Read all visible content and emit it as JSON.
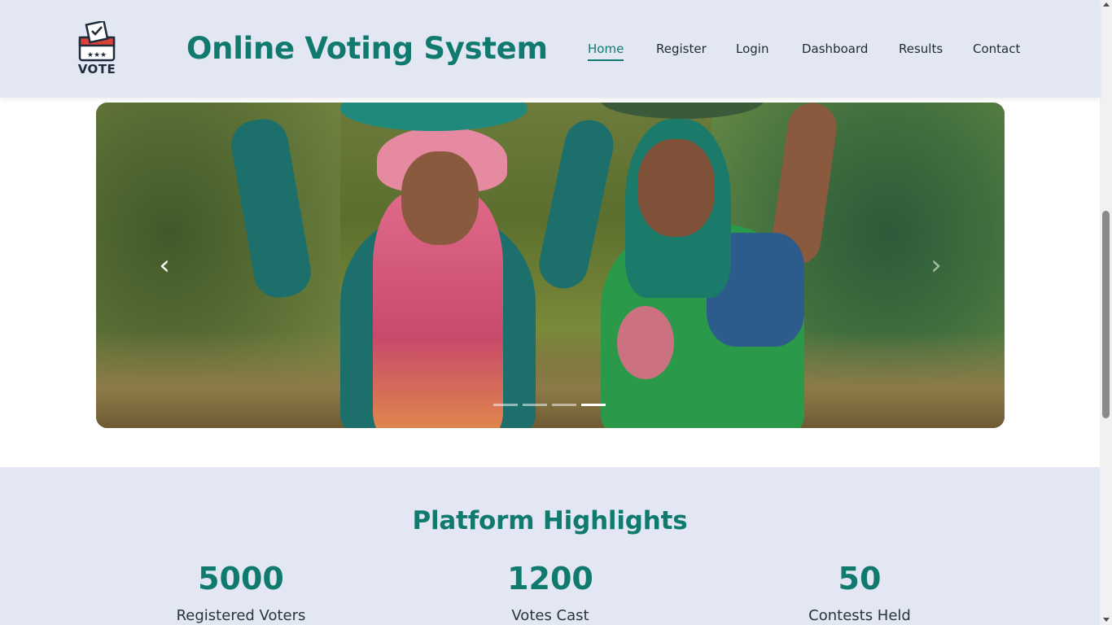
{
  "header": {
    "logo_text": "VOTE",
    "title": "Online Voting System"
  },
  "nav": {
    "items": [
      {
        "label": "Home",
        "active": true
      },
      {
        "label": "Register",
        "active": false
      },
      {
        "label": "Login",
        "active": false
      },
      {
        "label": "Dashboard",
        "active": false
      },
      {
        "label": "Results",
        "active": false
      },
      {
        "label": "Contact",
        "active": false
      }
    ]
  },
  "carousel": {
    "prev_symbol": "‹",
    "next_symbol": "›",
    "slide_count": 4,
    "active_slide": 4
  },
  "highlights": {
    "title": "Platform Highlights",
    "stats": [
      {
        "value": "5000",
        "label": "Registered Voters"
      },
      {
        "value": "1200",
        "label": "Votes Cast"
      },
      {
        "value": "50",
        "label": "Contests Held"
      }
    ]
  },
  "colors": {
    "accent": "#117a6f",
    "header_bg": "#e3e7f3",
    "text": "#1f2a35"
  }
}
